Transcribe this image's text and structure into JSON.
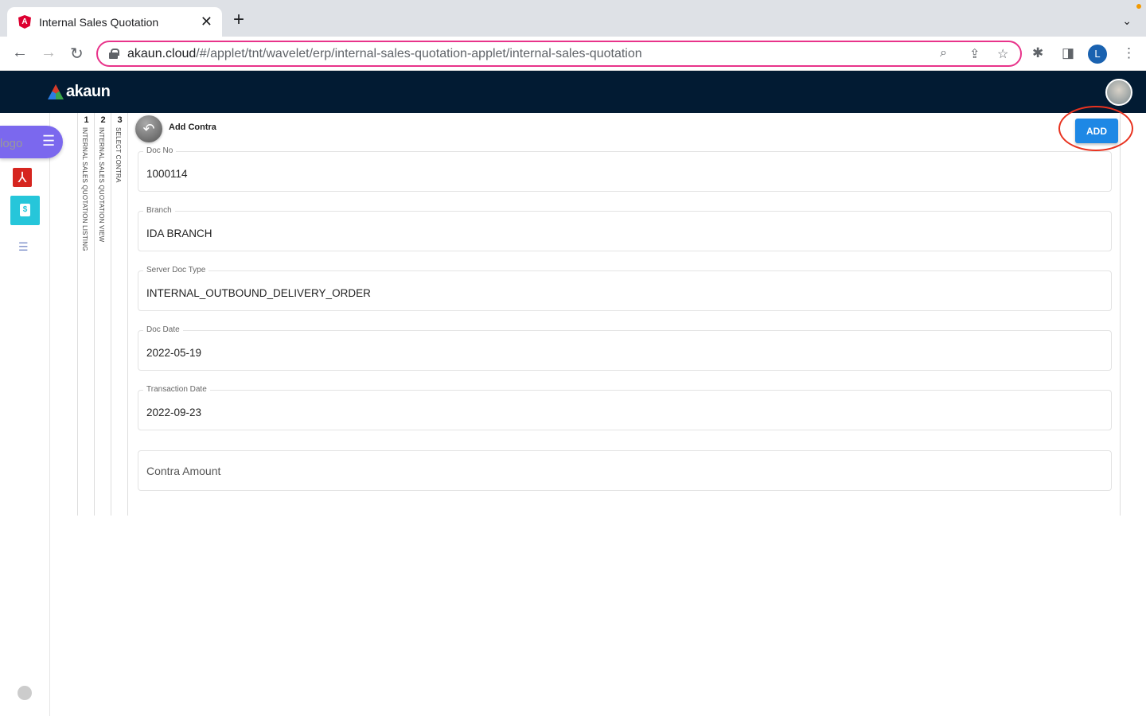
{
  "browser": {
    "tab_title": "Internal Sales Quotation",
    "url_host": "akaun.cloud",
    "url_path": "/#/applet/tnt/wavelet/erp/internal-sales-quotation-applet/internal-sales-quotation",
    "profile_initial": "L"
  },
  "header": {
    "brand": "akaun"
  },
  "sidebar": {
    "logo_alt": "logo"
  },
  "steps": [
    {
      "num": "1",
      "label": "INTERNAL SALES QUOTATION LISTING"
    },
    {
      "num": "2",
      "label": "INTERNAL SALES QUOTATION VIEW"
    },
    {
      "num": "3",
      "label": "SELECT CONTRA"
    }
  ],
  "panel": {
    "title": "Add Contra",
    "add_label": "ADD",
    "fields": [
      {
        "label": "Doc No",
        "value": "1000114"
      },
      {
        "label": "Branch",
        "value": "IDA BRANCH"
      },
      {
        "label": "Server Doc Type",
        "value": "INTERNAL_OUTBOUND_DELIVERY_ORDER"
      },
      {
        "label": "Doc Date",
        "value": "2022-05-19"
      },
      {
        "label": "Transaction Date",
        "value": "2022-09-23"
      }
    ],
    "contra_placeholder": "Contra Amount"
  },
  "colors": {
    "header": "#021b33",
    "accent": "#1e88e5",
    "menu": "#7b68ee",
    "highlight": "#e8321f"
  }
}
